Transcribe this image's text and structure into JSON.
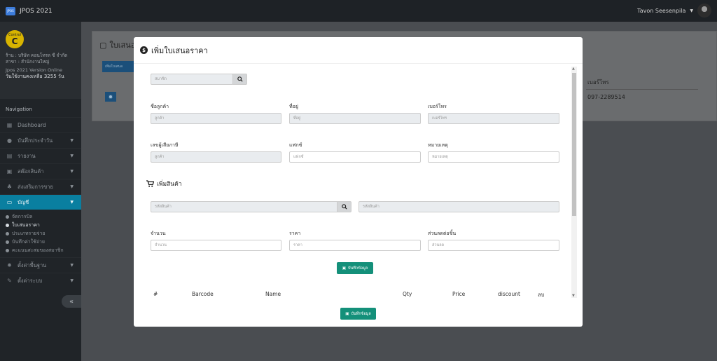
{
  "app": {
    "logo_text": "JPOS",
    "title": "JPOS 2021",
    "user_name": "Tavon Seesenpila"
  },
  "profile": {
    "badge_top": "Control",
    "badge_letter": "C",
    "shop": "ร้าน : บริษัท คอนโทรล ซี จำกัด",
    "branch": "สาขา : สำนักงานใหญ่",
    "version": "Jpos 2021 Version Online",
    "days_left": "วันใช้งานคงเหลือ 3255 วัน"
  },
  "nav": {
    "heading": "Navigation",
    "items": [
      {
        "label": "Dashboard",
        "icon": "dashboard-icon"
      },
      {
        "label": "บันทึกประจำวัน",
        "icon": "user-icon"
      },
      {
        "label": "รายงาน",
        "icon": "report-icon"
      },
      {
        "label": "สต๊อกสินค้า",
        "icon": "stock-icon"
      },
      {
        "label": "ส่งเสริมการขาย",
        "icon": "promo-icon"
      },
      {
        "label": "บัญชี",
        "icon": "laptop-icon"
      }
    ],
    "subitems": [
      "จัดการบิล",
      "ใบเสนอราคา",
      "ประเภทรายจ่าย",
      "บันทึกค่าใช้จ่าย",
      "คะแนนสะสมของสมาชิก"
    ],
    "bottom_items": [
      {
        "label": "ตั้งค่าพื้นฐาน",
        "icon": "gear-icon"
      },
      {
        "label": "ตั้งค่าระบบ",
        "icon": "wrench-icon"
      }
    ]
  },
  "background": {
    "title": "ใบเสนอ",
    "add_button": "เพิ่มใบเสนอ",
    "column_phone": "เบอร์โทร",
    "phone_value": "097-2289514"
  },
  "modal": {
    "title": "เพิ่มใบเสนอราคา",
    "member_placeholder": "สมาชิก",
    "customer_name_label": "ชื่อลูกค้า",
    "customer_name_placeholder": "ลูกค้า",
    "address_label": "ที่อยู่",
    "address_placeholder": "ที่อยู่",
    "phone_label": "เบอร์โทร",
    "phone_placeholder": "เบอร์โทร",
    "tax_label": "เลขผู้เสียภาษี",
    "tax_placeholder": "ลูกค้า",
    "fax_label": "แฟกซ์",
    "fax_placeholder": "แฟกซ์",
    "note_label": "หมายเหตุ",
    "note_placeholder": "หมายเหตุ",
    "add_product_title": "เพิ่มสินค้า",
    "product_code_placeholder": "รหัสสินค้า",
    "product_name_placeholder": "รหัสสินค้า",
    "qty_label": "จำนวน",
    "qty_placeholder": "จำนวน",
    "price_label": "ราคา",
    "price_placeholder": "ราคา",
    "discount_label": "ส่วนลดต่อชิ้น",
    "discount_placeholder": "ส่วนลด",
    "save_inner": "บันทึกข้อมูล",
    "table_headers": [
      "#",
      "Barcode",
      "Name",
      "Qty",
      "Price",
      "discount",
      "ลบ"
    ],
    "save_footer": "บันทึกข้อมูล"
  },
  "colors": {
    "accent": "#0a7fa0",
    "save": "#14907a",
    "badge": "#d8b400"
  }
}
